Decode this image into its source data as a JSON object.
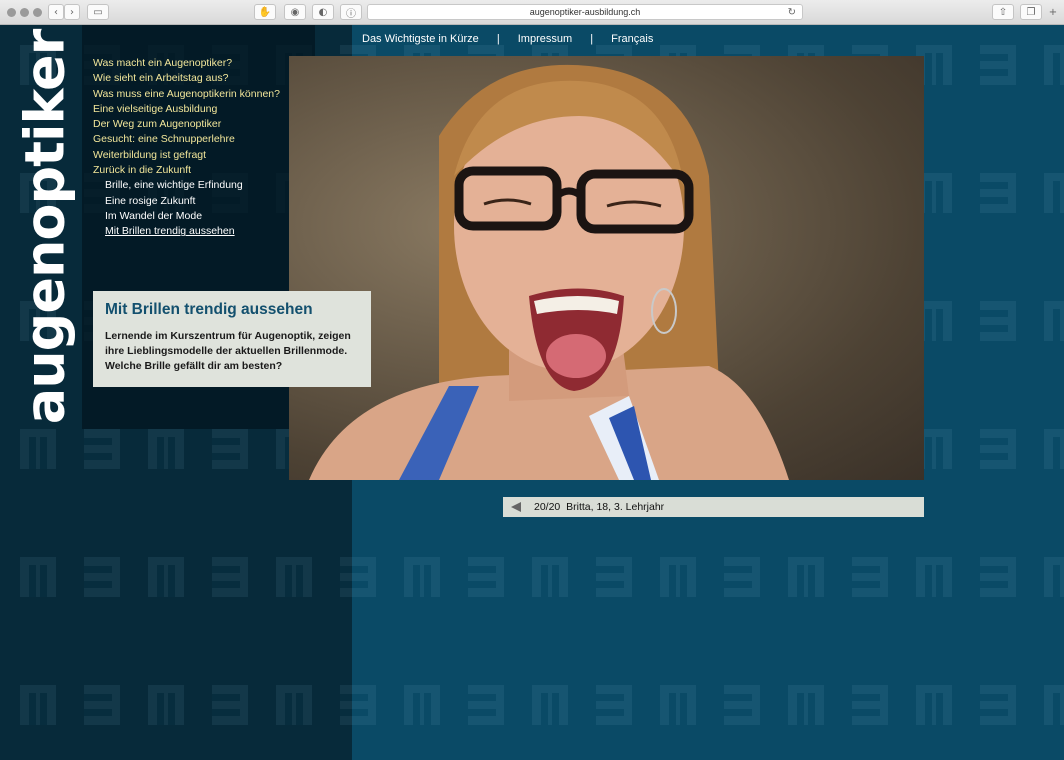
{
  "browser": {
    "url": "augenoptiker-ausbildung.ch"
  },
  "site": {
    "logo": "augenoptiker"
  },
  "topnav": {
    "items": [
      "Das Wichtigste in Kürze",
      "Impressum",
      "Français"
    ],
    "separator": "|"
  },
  "nav": {
    "items": [
      "Was macht ein Augenoptiker?",
      "Wie sieht ein Arbeitstag aus?",
      "Was muss eine Augenoptikerin können?",
      "Eine vielseitige Ausbildung",
      "Der Weg zum Augenoptiker",
      "Gesucht: eine Schnupperlehre",
      "Weiterbildung ist gefragt",
      "Zurück in die Zukunft"
    ],
    "subitems": [
      "Brille, eine wichtige Erfindung",
      "Eine rosige Zukunft",
      "Im Wandel der Mode",
      "Mit Brillen trendig aussehen"
    ]
  },
  "caption": {
    "title": "Mit Brillen trendig aussehen",
    "text": "Lernende im Kurszentrum für Augenoptik, zeigen ihre Lieblingsmodelle der aktuellen Brillenmode. Welche Brille gefällt dir am besten?"
  },
  "gallery": {
    "counter": "20/20",
    "caption": "Britta, 18, 3. Lehrjahr"
  },
  "colors": {
    "page_bg": "#0a4a66",
    "left_band": "#072a3a",
    "nav_yellow": "#f2e69a",
    "caption_title": "#13506e"
  }
}
